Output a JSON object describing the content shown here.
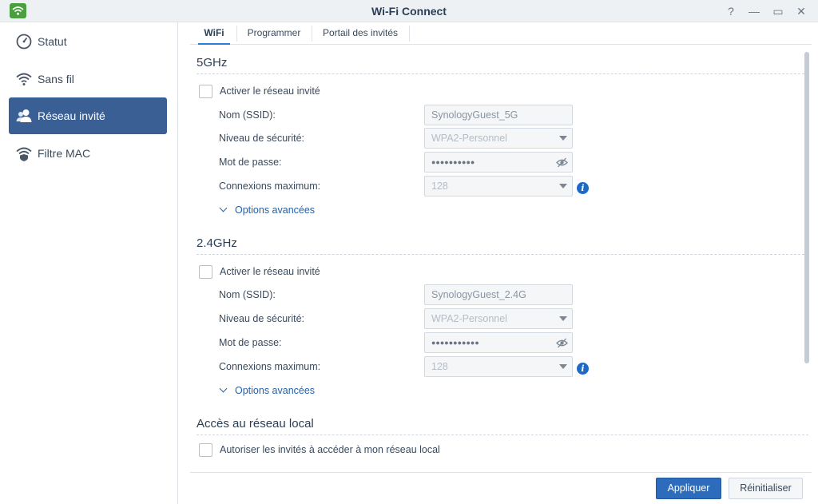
{
  "window": {
    "title": "Wi-Fi Connect",
    "controls": {
      "help": "?",
      "minimize": "—",
      "maximize": "▭",
      "close": "✕"
    }
  },
  "sidebar": {
    "items": [
      {
        "label": "Statut",
        "icon": "gauge-icon",
        "active": false
      },
      {
        "label": "Sans fil",
        "icon": "wifi-icon",
        "active": false
      },
      {
        "label": "Réseau invité",
        "icon": "guest-users-icon",
        "active": true
      },
      {
        "label": "Filtre MAC",
        "icon": "wifi-shield-icon",
        "active": false
      }
    ]
  },
  "tabs": [
    {
      "label": "WiFi",
      "active": true
    },
    {
      "label": "Programmer",
      "active": false
    },
    {
      "label": "Portail des invités",
      "active": false
    }
  ],
  "band5": {
    "title": "5GHz",
    "enable_label": "Activer le réseau invité",
    "ssid_label": "Nom (SSID):",
    "ssid_value": "SynologyGuest_5G",
    "security_label": "Niveau de sécurité:",
    "security_value": "WPA2-Personnel",
    "password_label": "Mot de passe:",
    "password_value": "●●●●●●●●●●",
    "max_label": "Connexions maximum:",
    "max_value": "128",
    "advanced_label": "Options avancées"
  },
  "band24": {
    "title": "2.4GHz",
    "enable_label": "Activer le réseau invité",
    "ssid_label": "Nom (SSID):",
    "ssid_value": "SynologyGuest_2.4G",
    "security_label": "Niveau de sécurité:",
    "security_value": "WPA2-Personnel",
    "password_label": "Mot de passe:",
    "password_value": "●●●●●●●●●●●",
    "max_label": "Connexions maximum:",
    "max_value": "128",
    "advanced_label": "Options avancées"
  },
  "local": {
    "title": "Accès au réseau local",
    "allow_label": "Autoriser les invités à accéder à mon réseau local"
  },
  "footer": {
    "apply_label": "Appliquer",
    "reset_label": "Réinitialiser"
  },
  "colors": {
    "accent": "#3a5f95",
    "primary_button": "#2d6cbd",
    "link": "#2561a8",
    "info": "#1d69c6"
  }
}
